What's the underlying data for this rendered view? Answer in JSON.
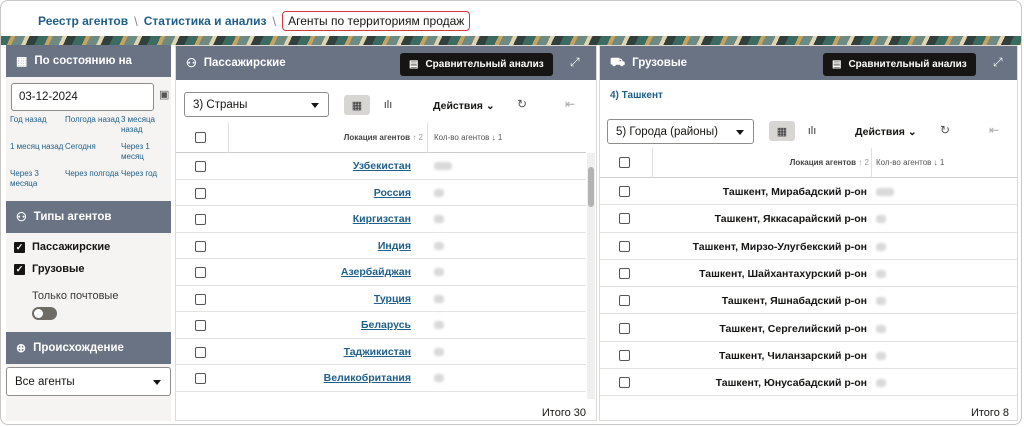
{
  "breadcrumb": {
    "item1": "Реестр агентов",
    "item2": "Статистика и анализ",
    "current": "Агенты по территориям продаж"
  },
  "left": {
    "state_title": "По состоянию на",
    "date_value": "03-12-2024",
    "quick_dates": [
      "Год назад",
      "Полгода назад",
      "3 месяца назад",
      "1 месяц назад",
      "Сегодня",
      "Через 1 месяц",
      "Через 3 месяца",
      "Через полгода",
      "Через год"
    ],
    "agent_types_title": "Типы агентов",
    "passenger_label": "Пассажирские",
    "cargo_label": "Грузовые",
    "only_postal_label": "Только почтовые",
    "origin_title": "Происхождение",
    "origin_value": "Все агенты"
  },
  "passenger": {
    "title": "Пассажирские",
    "compare_label": "Сравнительный анализ",
    "level_value": "3) Страны",
    "actions_label": "Действия",
    "col_location": "Локация агентов",
    "col_count": "Кол-во агентов",
    "rows": [
      "Узбекистан",
      "Россия",
      "Киргизстан",
      "Индия",
      "Азербайджан",
      "Турция",
      "Беларусь",
      "Таджикистан",
      "Великобритания"
    ],
    "total": "Итого 30"
  },
  "cargo": {
    "title": "Грузовые",
    "compare_label": "Сравнительный анализ",
    "subtitle": "4) Ташкент",
    "level_value": "5) Города (районы)",
    "actions_label": "Действия",
    "col_location": "Локация агентов",
    "col_count": "Кол-во агентов",
    "rows": [
      "Ташкент, Мирабадский р-он",
      "Ташкент, Яккасарайский р-он",
      "Ташкент, Мирзо-Улугбекский р-он",
      "Ташкент, Шайхантахурский р-он",
      "Ташкент, Яшнабадский р-он",
      "Ташкент, Сергелийский р-он",
      "Ташкент, Чиланзарский р-он",
      "Ташкент, Юнусабадский р-он"
    ],
    "total": "Итого 8"
  }
}
